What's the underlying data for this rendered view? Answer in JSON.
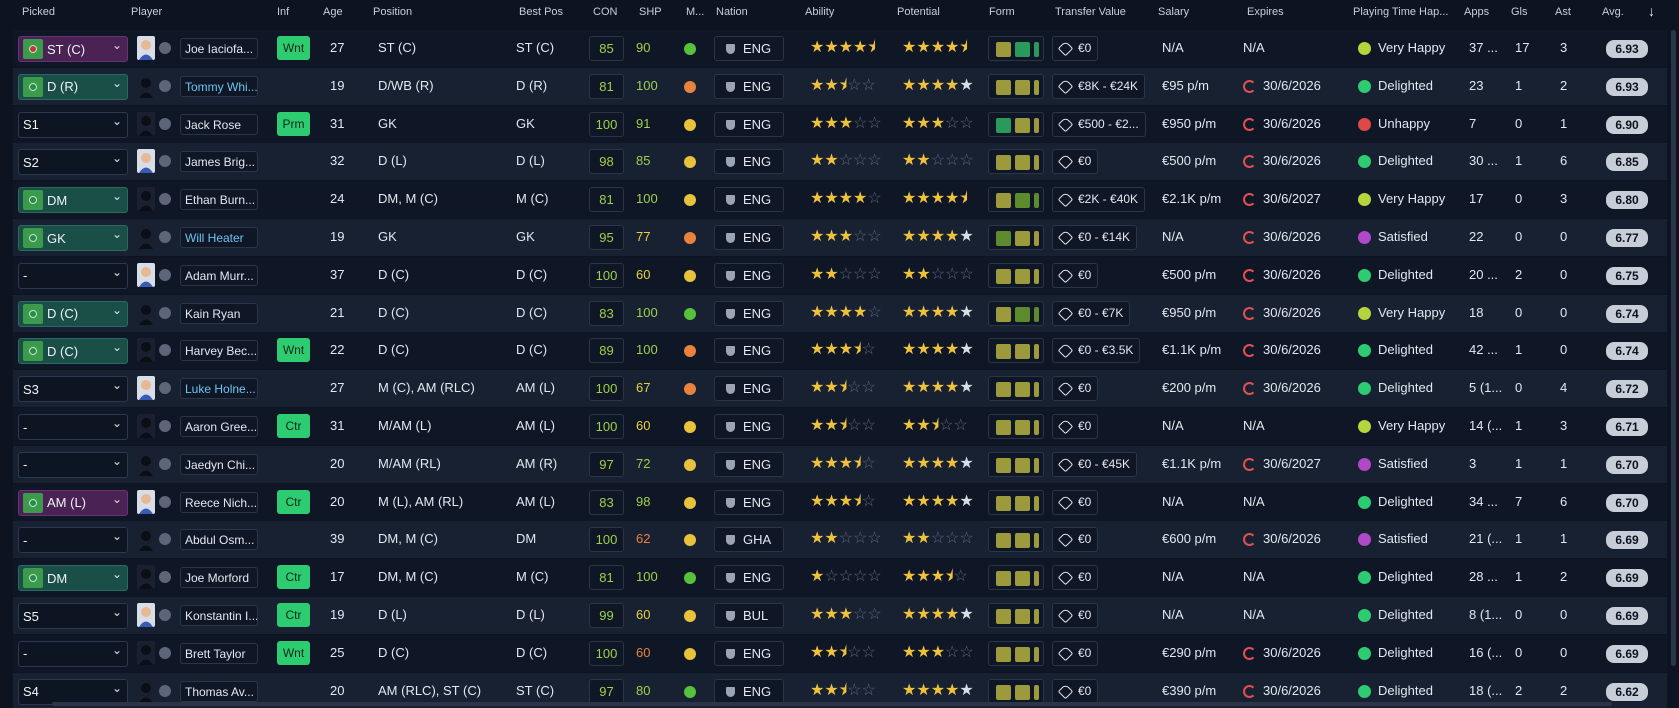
{
  "columns": {
    "picked": "Picked",
    "player": "Player",
    "inf": "Inf",
    "age": "Age",
    "position": "Position",
    "best_pos": "Best Pos",
    "con": "CON",
    "shp": "SHP",
    "morale": "M...",
    "nation": "Nation",
    "ability": "Ability",
    "potential": "Potential",
    "form": "Form",
    "transfer_value": "Transfer Value",
    "salary": "Salary",
    "expires": "Expires",
    "happiness": "Playing Time Hap...",
    "apps": "Apps",
    "gls": "Gls",
    "ast": "Ast",
    "avg": "Avg.",
    "sort_icon": "↓"
  },
  "colors": {
    "accent_green": "#2ecc71",
    "rating_pill": "#c8ced8",
    "star": "#f0c23c",
    "expiry_red": "#e05050"
  },
  "players": [
    {
      "picked": "ST (C)",
      "picked_style": "purple",
      "pitch": "red",
      "name": "Joe Iaciofa...",
      "name_blue": false,
      "inf": "Wnt",
      "age": "27",
      "position": "ST (C)",
      "best_pos": "ST (C)",
      "con": "85",
      "shp": "90",
      "shp_color": "green",
      "morale": "#56c23c",
      "nation": "ENG",
      "ability": [
        1,
        1,
        1,
        1,
        0.5
      ],
      "ability_white": false,
      "potential": [
        1,
        1,
        1,
        1,
        0.5
      ],
      "potential_white": false,
      "form": [
        "#9c9a3c",
        "#2a9a5c"
      ],
      "tv": "€0",
      "salary": "N/A",
      "expires": "N/A",
      "expires_clock": false,
      "happiness": "Very Happy",
      "hap_color": "#b6d43c",
      "apps": "37 ...",
      "gls": "17",
      "ast": "3",
      "avg": "6.93"
    },
    {
      "picked": "D (R)",
      "picked_style": "green",
      "pitch": "green",
      "name": "Tommy Whi...",
      "name_blue": true,
      "inf": "",
      "age": "19",
      "position": "D/WB (R)",
      "best_pos": "D (R)",
      "con": "81",
      "shp": "100",
      "shp_color": "green",
      "morale": "#e8823c",
      "nation": "ENG",
      "ability": [
        1,
        1,
        0.5,
        0,
        0
      ],
      "ability_white": false,
      "potential": [
        1,
        1,
        1,
        1,
        0
      ],
      "potential_white": true,
      "form": [
        "#9c9a3c",
        "#9c9a3c"
      ],
      "tv": "€8K - €24K",
      "salary": "€95 p/m",
      "expires": "30/6/2026",
      "expires_clock": true,
      "happiness": "Delighted",
      "hap_color": "#2ecc71",
      "apps": "23",
      "gls": "1",
      "ast": "2",
      "avg": "6.93"
    },
    {
      "picked": "S1",
      "picked_style": "plain",
      "pitch": "",
      "name": "Jack Rose",
      "name_blue": false,
      "inf": "Prm",
      "age": "31",
      "position": "GK",
      "best_pos": "GK",
      "con": "100",
      "shp": "91",
      "shp_color": "green",
      "morale": "#e8c23c",
      "nation": "ENG",
      "ability": [
        1,
        1,
        1,
        0,
        0
      ],
      "ability_white": false,
      "potential": [
        1,
        1,
        1,
        0,
        0
      ],
      "potential_white": false,
      "form": [
        "#2a9a5c",
        "#9c9a3c"
      ],
      "tv": "€500 - €2...",
      "salary": "€950 p/m",
      "expires": "30/6/2026",
      "expires_clock": true,
      "happiness": "Unhappy",
      "hap_color": "#e04848",
      "apps": "7",
      "gls": "0",
      "ast": "1",
      "avg": "6.90"
    },
    {
      "picked": "S2",
      "picked_style": "plain",
      "pitch": "",
      "name": "James Brig...",
      "name_blue": false,
      "inf": "",
      "age": "32",
      "position": "D (L)",
      "best_pos": "D (L)",
      "con": "98",
      "shp": "85",
      "shp_color": "green",
      "morale": "#e8c23c",
      "nation": "ENG",
      "ability": [
        1,
        1,
        0,
        0,
        0
      ],
      "ability_white": false,
      "potential": [
        1,
        1,
        0,
        0,
        0
      ],
      "potential_white": false,
      "form": [
        "#9c9a3c",
        "#9c9a3c"
      ],
      "tv": "€0",
      "salary": "€500 p/m",
      "expires": "30/6/2026",
      "expires_clock": true,
      "happiness": "Delighted",
      "hap_color": "#2ecc71",
      "apps": "30 ...",
      "gls": "1",
      "ast": "6",
      "avg": "6.85"
    },
    {
      "picked": "DM",
      "picked_style": "green",
      "pitch": "green",
      "name": "Ethan Burn...",
      "name_blue": false,
      "inf": "",
      "age": "24",
      "position": "DM, M (C)",
      "best_pos": "M (C)",
      "con": "81",
      "shp": "100",
      "shp_color": "green",
      "morale": "#e8c23c",
      "nation": "ENG",
      "ability": [
        1,
        1,
        1,
        1,
        0
      ],
      "ability_white": false,
      "potential": [
        1,
        1,
        1,
        1,
        0.5
      ],
      "potential_white": false,
      "form": [
        "#9c9a3c",
        "#5c8a2c"
      ],
      "tv": "€2K - €40K",
      "salary": "€2.1K p/m",
      "expires": "30/6/2027",
      "expires_clock": true,
      "happiness": "Very Happy",
      "hap_color": "#b6d43c",
      "apps": "17",
      "gls": "0",
      "ast": "3",
      "avg": "6.80"
    },
    {
      "picked": "GK",
      "picked_style": "green",
      "pitch": "green",
      "name": "Will Heater",
      "name_blue": true,
      "inf": "",
      "age": "19",
      "position": "GK",
      "best_pos": "GK",
      "con": "95",
      "shp": "77",
      "shp_color": "yellow",
      "morale": "#e8823c",
      "nation": "ENG",
      "ability": [
        1,
        1,
        1,
        0,
        0
      ],
      "ability_white": false,
      "potential": [
        1,
        1,
        1,
        1,
        0
      ],
      "potential_white": true,
      "form": [
        "#5c8a2c",
        "#9c9a3c"
      ],
      "tv": "€0 - €14K",
      "salary": "N/A",
      "expires": "30/6/2026",
      "expires_clock": true,
      "happiness": "Satisfied",
      "hap_color": "#b048c8",
      "apps": "22",
      "gls": "0",
      "ast": "0",
      "avg": "6.77"
    },
    {
      "picked": "-",
      "picked_style": "plain",
      "pitch": "",
      "name": "Adam Murr...",
      "name_blue": false,
      "inf": "",
      "age": "37",
      "position": "D (C)",
      "best_pos": "D (C)",
      "con": "100",
      "shp": "60",
      "shp_color": "yellow",
      "morale": "#e8c23c",
      "nation": "ENG",
      "ability": [
        1,
        1,
        0,
        0,
        0
      ],
      "ability_white": false,
      "potential": [
        1,
        1,
        0,
        0,
        0
      ],
      "potential_white": false,
      "form": [
        "#9c9a3c",
        "#9c9a3c"
      ],
      "tv": "€0",
      "salary": "€500 p/m",
      "expires": "30/6/2026",
      "expires_clock": true,
      "happiness": "Delighted",
      "hap_color": "#2ecc71",
      "apps": "20 ...",
      "gls": "2",
      "ast": "0",
      "avg": "6.75"
    },
    {
      "picked": "D (C)",
      "picked_style": "green",
      "pitch": "green",
      "name": "Kain Ryan",
      "name_blue": false,
      "inf": "",
      "age": "21",
      "position": "D (C)",
      "best_pos": "D (C)",
      "con": "83",
      "shp": "100",
      "shp_color": "green",
      "morale": "#56c23c",
      "nation": "ENG",
      "ability": [
        1,
        1,
        1,
        1,
        0
      ],
      "ability_white": false,
      "potential": [
        1,
        1,
        1,
        1,
        0
      ],
      "potential_white": true,
      "form": [
        "#9c9a3c",
        "#5c8a2c"
      ],
      "tv": "€0 - €7K",
      "salary": "€950 p/m",
      "expires": "30/6/2026",
      "expires_clock": true,
      "happiness": "Very Happy",
      "hap_color": "#b6d43c",
      "apps": "18",
      "gls": "0",
      "ast": "0",
      "avg": "6.74"
    },
    {
      "picked": "D (C)",
      "picked_style": "green",
      "pitch": "green",
      "name": "Harvey Bec...",
      "name_blue": false,
      "inf": "Wnt",
      "age": "22",
      "position": "D (C)",
      "best_pos": "D (C)",
      "con": "89",
      "shp": "100",
      "shp_color": "green",
      "morale": "#e8823c",
      "nation": "ENG",
      "ability": [
        1,
        1,
        1,
        0.5,
        0
      ],
      "ability_white": false,
      "potential": [
        1,
        1,
        1,
        1,
        0
      ],
      "potential_white": true,
      "form": [
        "#9c9a3c",
        "#9c9a3c"
      ],
      "tv": "€0 - €3.5K",
      "salary": "€1.1K p/m",
      "expires": "30/6/2026",
      "expires_clock": true,
      "happiness": "Delighted",
      "hap_color": "#2ecc71",
      "apps": "42 ...",
      "gls": "1",
      "ast": "0",
      "avg": "6.74"
    },
    {
      "picked": "S3",
      "picked_style": "plain",
      "pitch": "",
      "name": "Luke Holne...",
      "name_blue": true,
      "inf": "",
      "age": "27",
      "position": "M (C), AM (RLC)",
      "best_pos": "AM (L)",
      "con": "100",
      "shp": "67",
      "shp_color": "yellow",
      "morale": "#e8823c",
      "nation": "ENG",
      "ability": [
        1,
        1,
        0.5,
        0,
        0
      ],
      "ability_white": false,
      "potential": [
        1,
        1,
        1,
        1,
        0
      ],
      "potential_white": true,
      "form": [
        "#9c9a3c",
        "#9c9a3c"
      ],
      "tv": "€0",
      "salary": "€200 p/m",
      "expires": "30/6/2026",
      "expires_clock": true,
      "happiness": "Delighted",
      "hap_color": "#2ecc71",
      "apps": "5 (1...",
      "gls": "0",
      "ast": "4",
      "avg": "6.72"
    },
    {
      "picked": "-",
      "picked_style": "plain",
      "pitch": "",
      "name": "Aaron Gree...",
      "name_blue": false,
      "inf": "Ctr",
      "age": "31",
      "position": "M/AM (L)",
      "best_pos": "AM (L)",
      "con": "100",
      "shp": "60",
      "shp_color": "yellow",
      "morale": "#e8c23c",
      "nation": "ENG",
      "ability": [
        1,
        1,
        0.5,
        0,
        0
      ],
      "ability_white": false,
      "potential": [
        1,
        1,
        0.5,
        0,
        0
      ],
      "potential_white": false,
      "form": [
        "#9c9a3c",
        "#9c9a3c"
      ],
      "tv": "€0",
      "salary": "N/A",
      "expires": "N/A",
      "expires_clock": false,
      "happiness": "Very Happy",
      "hap_color": "#b6d43c",
      "apps": "14 (...",
      "gls": "1",
      "ast": "3",
      "avg": "6.71"
    },
    {
      "picked": "-",
      "picked_style": "plain",
      "pitch": "",
      "name": "Jaedyn Chi...",
      "name_blue": false,
      "inf": "",
      "age": "20",
      "position": "M/AM (RL)",
      "best_pos": "AM (R)",
      "con": "97",
      "shp": "72",
      "shp_color": "green",
      "morale": "#e8c23c",
      "nation": "ENG",
      "ability": [
        1,
        1,
        1,
        0.5,
        0
      ],
      "ability_white": false,
      "potential": [
        1,
        1,
        1,
        1,
        0
      ],
      "potential_white": true,
      "form": [
        "#9c9a3c",
        "#9c9a3c"
      ],
      "tv": "€0 - €45K",
      "salary": "€1.1K p/m",
      "expires": "30/6/2027",
      "expires_clock": true,
      "happiness": "Satisfied",
      "hap_color": "#b048c8",
      "apps": "3",
      "gls": "1",
      "ast": "1",
      "avg": "6.70"
    },
    {
      "picked": "AM (L)",
      "picked_style": "purple",
      "pitch": "green",
      "name": "Reece Nich...",
      "name_blue": false,
      "inf": "Ctr",
      "age": "20",
      "position": "M (L), AM (RL)",
      "best_pos": "AM (L)",
      "con": "83",
      "shp": "98",
      "shp_color": "green",
      "morale": "#e8c23c",
      "nation": "ENG",
      "ability": [
        1,
        1,
        1,
        0.5,
        0
      ],
      "ability_white": false,
      "potential": [
        1,
        1,
        1,
        1,
        0
      ],
      "potential_white": true,
      "form": [
        "#9c9a3c",
        "#9c9a3c"
      ],
      "tv": "€0",
      "salary": "N/A",
      "expires": "N/A",
      "expires_clock": false,
      "happiness": "Delighted",
      "hap_color": "#2ecc71",
      "apps": "34 ...",
      "gls": "7",
      "ast": "6",
      "avg": "6.70"
    },
    {
      "picked": "-",
      "picked_style": "plain",
      "pitch": "",
      "name": "Abdul Osm...",
      "name_blue": false,
      "inf": "",
      "age": "39",
      "position": "DM, M (C)",
      "best_pos": "DM",
      "con": "100",
      "shp": "62",
      "shp_color": "orange",
      "morale": "#e8c23c",
      "nation": "GHA",
      "ability": [
        1,
        1,
        0,
        0,
        0
      ],
      "ability_white": false,
      "potential": [
        1,
        1,
        0,
        0,
        0
      ],
      "potential_white": false,
      "form": [
        "#9c9a3c",
        "#9c9a3c"
      ],
      "tv": "€0",
      "salary": "€600 p/m",
      "expires": "30/6/2026",
      "expires_clock": true,
      "happiness": "Satisfied",
      "hap_color": "#b048c8",
      "apps": "21 (...",
      "gls": "1",
      "ast": "1",
      "avg": "6.69"
    },
    {
      "picked": "DM",
      "picked_style": "green",
      "pitch": "green",
      "name": "Joe Morford",
      "name_blue": false,
      "inf": "Ctr",
      "age": "17",
      "position": "DM, M (C)",
      "best_pos": "M (C)",
      "con": "81",
      "shp": "100",
      "shp_color": "green",
      "morale": "#56c23c",
      "nation": "ENG",
      "ability": [
        1,
        0,
        0,
        0,
        0
      ],
      "ability_white": false,
      "potential": [
        1,
        1,
        1,
        0.5,
        0
      ],
      "potential_white": false,
      "form": [
        "#9c9a3c",
        "#9c9a3c"
      ],
      "tv": "€0",
      "salary": "N/A",
      "expires": "N/A",
      "expires_clock": false,
      "happiness": "Delighted",
      "hap_color": "#2ecc71",
      "apps": "28 ...",
      "gls": "1",
      "ast": "2",
      "avg": "6.69"
    },
    {
      "picked": "S5",
      "picked_style": "plain",
      "pitch": "",
      "name": "Konstantin I...",
      "name_blue": false,
      "inf": "Ctr",
      "age": "19",
      "position": "D (L)",
      "best_pos": "D (L)",
      "con": "99",
      "shp": "60",
      "shp_color": "yellow",
      "morale": "#e8c23c",
      "nation": "BUL",
      "ability": [
        1,
        1,
        1,
        0,
        0
      ],
      "ability_white": false,
      "potential": [
        1,
        1,
        1,
        1,
        0
      ],
      "potential_white": true,
      "form": [
        "#9c9a3c",
        "#9c9a3c"
      ],
      "tv": "€0",
      "salary": "N/A",
      "expires": "N/A",
      "expires_clock": false,
      "happiness": "Delighted",
      "hap_color": "#2ecc71",
      "apps": "8 (1...",
      "gls": "0",
      "ast": "0",
      "avg": "6.69"
    },
    {
      "picked": "-",
      "picked_style": "plain",
      "pitch": "",
      "name": "Brett Taylor",
      "name_blue": false,
      "inf": "Wnt",
      "age": "25",
      "position": "D (C)",
      "best_pos": "D (C)",
      "con": "100",
      "shp": "60",
      "shp_color": "orange",
      "morale": "#e8c23c",
      "nation": "ENG",
      "ability": [
        1,
        1,
        0.5,
        0,
        0
      ],
      "ability_white": false,
      "potential": [
        1,
        1,
        1,
        0,
        0
      ],
      "potential_white": false,
      "form": [
        "#9c9a3c",
        "#9c9a3c"
      ],
      "tv": "€0",
      "salary": "€290 p/m",
      "expires": "30/6/2026",
      "expires_clock": true,
      "happiness": "Delighted",
      "hap_color": "#2ecc71",
      "apps": "16 (...",
      "gls": "0",
      "ast": "0",
      "avg": "6.69"
    },
    {
      "picked": "S4",
      "picked_style": "plain",
      "pitch": "",
      "name": "Thomas Av...",
      "name_blue": false,
      "inf": "",
      "age": "20",
      "position": "AM (RLC), ST (C)",
      "best_pos": "ST (C)",
      "con": "97",
      "shp": "80",
      "shp_color": "green",
      "morale": "#56c23c",
      "nation": "ENG",
      "ability": [
        1,
        1,
        0.5,
        0,
        0
      ],
      "ability_white": false,
      "potential": [
        1,
        1,
        1,
        1,
        0
      ],
      "potential_white": true,
      "form": [
        "#9c9a3c",
        "#9c9a3c"
      ],
      "tv": "€0",
      "salary": "€390 p/m",
      "expires": "30/6/2026",
      "expires_clock": true,
      "happiness": "Delighted",
      "hap_color": "#2ecc71",
      "apps": "18 (...",
      "gls": "2",
      "ast": "2",
      "avg": "6.62"
    }
  ]
}
